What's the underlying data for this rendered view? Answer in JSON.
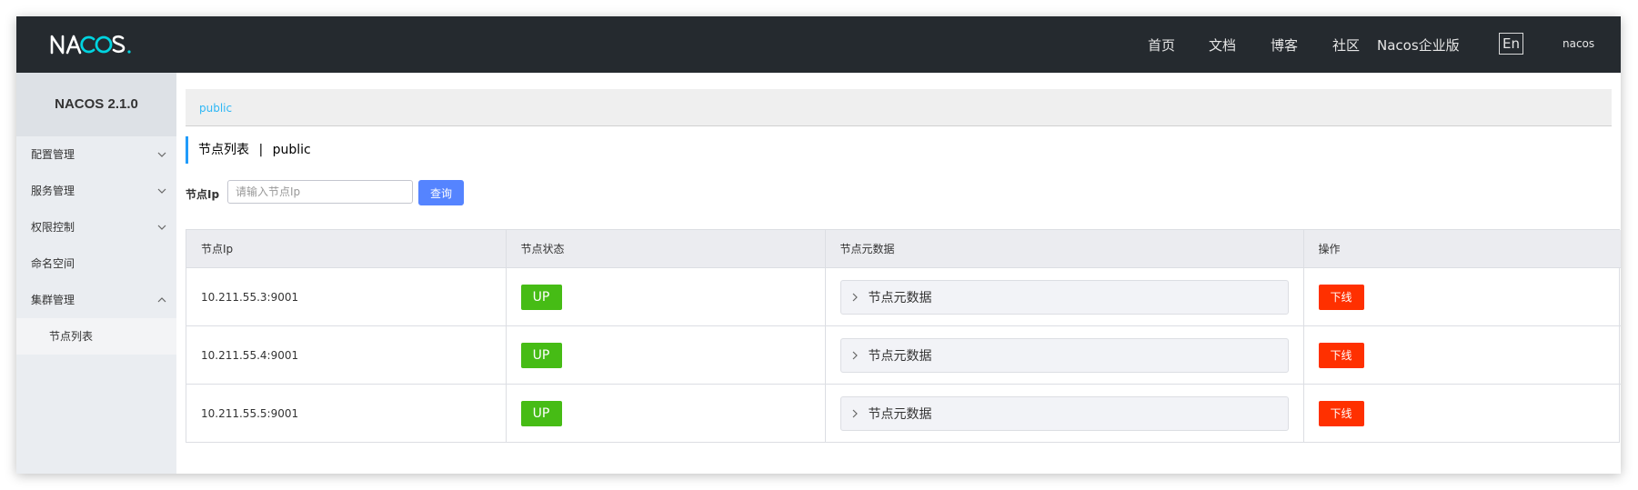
{
  "header": {
    "logo_text": "NACOS.",
    "nav": [
      {
        "label": "首页"
      },
      {
        "label": "文档"
      },
      {
        "label": "博客"
      },
      {
        "label": "社区"
      },
      {
        "label": "Nacos企业版"
      }
    ],
    "lang_label": "En",
    "user": "nacos",
    "background": "#252a2f"
  },
  "sidebar": {
    "title": "NACOS 2.1.0",
    "items": [
      {
        "label": "配置管理",
        "icon": "chevron-down-icon"
      },
      {
        "label": "服务管理",
        "icon": "chevron-down-icon"
      },
      {
        "label": "权限控制",
        "icon": "chevron-down-icon"
      },
      {
        "label": "命名空间"
      },
      {
        "label": "集群管理",
        "icon": "chevron-up-icon",
        "expanded": true
      }
    ],
    "subitems": [
      {
        "label": "节点列表"
      }
    ]
  },
  "main": {
    "namespace_link": "public",
    "page_title": "节点列表",
    "page_title_separator": "|",
    "page_title_namespace": "public",
    "search": {
      "label": "节点Ip",
      "placeholder": "请输入节点Ip",
      "value": "",
      "button_label": "查询"
    },
    "table": {
      "headers": [
        "节点Ip",
        "节点状态",
        "节点元数据",
        "操作"
      ],
      "rows": [
        {
          "ip": "10.211.55.3:9001",
          "state": "UP",
          "meta": "节点元数据",
          "action": "下线"
        },
        {
          "ip": "10.211.55.4:9001",
          "state": "UP",
          "meta": "节点元数据",
          "action": "下线"
        },
        {
          "ip": "10.211.55.5:9001",
          "state": "UP",
          "meta": "节点元数据",
          "action": "下线"
        }
      ]
    }
  },
  "colors": {
    "accent": "#5584ff",
    "link": "#2db7f5",
    "state_up": "#46bc15",
    "danger": "#ff3000"
  }
}
